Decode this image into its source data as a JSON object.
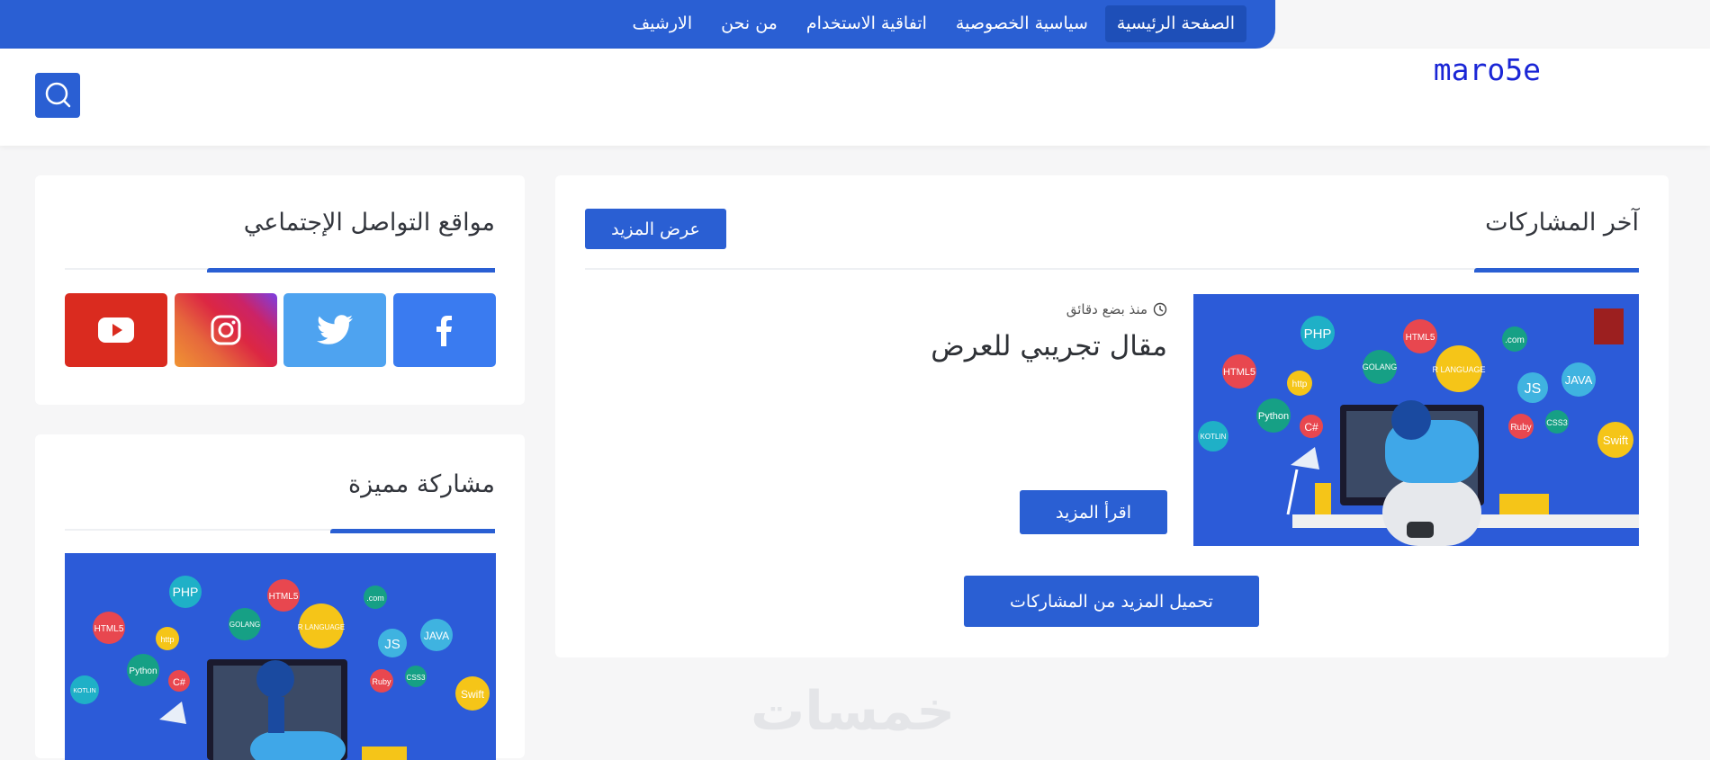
{
  "nav": {
    "items": [
      {
        "label": "الصفحة الرئيسية",
        "active": true
      },
      {
        "label": "سياسية الخصوصية",
        "active": false
      },
      {
        "label": "اتفاقية الاستخدام",
        "active": false
      },
      {
        "label": "من نحن",
        "active": false
      },
      {
        "label": "الارشيف",
        "active": false
      }
    ]
  },
  "header": {
    "logo": "maro5e",
    "search_icon": "search-icon"
  },
  "latest": {
    "title": "آخر المشاركات",
    "more_button": "عرض المزيد",
    "post": {
      "time": "منذ بضع دقائق",
      "title": "مقال تجريبي للعرض",
      "read_more": "اقرأ المزيد"
    },
    "load_more": "تحميل المزيد من المشاركات"
  },
  "social": {
    "title": "مواقع التواصل الإجتماعي",
    "links": [
      {
        "icon": "facebook-icon",
        "color": "#3a7bf0"
      },
      {
        "icon": "twitter-icon",
        "color": "#4ea3f0"
      },
      {
        "icon": "instagram-icon",
        "color": "#c13584"
      },
      {
        "icon": "youtube-icon",
        "color": "#da2b1f"
      }
    ]
  },
  "featured": {
    "title": "مشاركة مميزة"
  },
  "illustration_tags": [
    "PHP",
    "HTML5",
    ".com",
    "HTML5",
    "GOLANG",
    "R LANGUAGE",
    "JS",
    "JAVA",
    "http",
    "Python",
    "C#",
    "Ruby",
    "CSS3",
    "KOTLIN",
    "Swift"
  ],
  "watermark": "خمسات",
  "colors": {
    "accent": "#2a5fd3",
    "logo": "#1a26d6",
    "illustration_bg": "#2c5bd8"
  }
}
